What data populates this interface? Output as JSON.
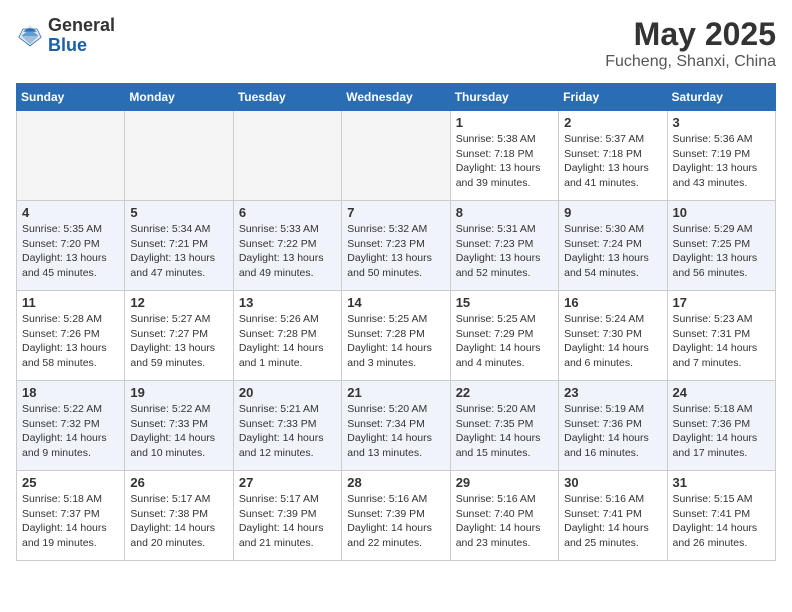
{
  "header": {
    "logo": {
      "general": "General",
      "blue": "Blue"
    },
    "title": "May 2025",
    "location": "Fucheng, Shanxi, China"
  },
  "weekdays": [
    "Sunday",
    "Monday",
    "Tuesday",
    "Wednesday",
    "Thursday",
    "Friday",
    "Saturday"
  ],
  "weeks": [
    [
      {
        "day": "",
        "info": ""
      },
      {
        "day": "",
        "info": ""
      },
      {
        "day": "",
        "info": ""
      },
      {
        "day": "",
        "info": ""
      },
      {
        "day": "1",
        "info": "Sunrise: 5:38 AM\nSunset: 7:18 PM\nDaylight: 13 hours\nand 39 minutes."
      },
      {
        "day": "2",
        "info": "Sunrise: 5:37 AM\nSunset: 7:18 PM\nDaylight: 13 hours\nand 41 minutes."
      },
      {
        "day": "3",
        "info": "Sunrise: 5:36 AM\nSunset: 7:19 PM\nDaylight: 13 hours\nand 43 minutes."
      }
    ],
    [
      {
        "day": "4",
        "info": "Sunrise: 5:35 AM\nSunset: 7:20 PM\nDaylight: 13 hours\nand 45 minutes."
      },
      {
        "day": "5",
        "info": "Sunrise: 5:34 AM\nSunset: 7:21 PM\nDaylight: 13 hours\nand 47 minutes."
      },
      {
        "day": "6",
        "info": "Sunrise: 5:33 AM\nSunset: 7:22 PM\nDaylight: 13 hours\nand 49 minutes."
      },
      {
        "day": "7",
        "info": "Sunrise: 5:32 AM\nSunset: 7:23 PM\nDaylight: 13 hours\nand 50 minutes."
      },
      {
        "day": "8",
        "info": "Sunrise: 5:31 AM\nSunset: 7:23 PM\nDaylight: 13 hours\nand 52 minutes."
      },
      {
        "day": "9",
        "info": "Sunrise: 5:30 AM\nSunset: 7:24 PM\nDaylight: 13 hours\nand 54 minutes."
      },
      {
        "day": "10",
        "info": "Sunrise: 5:29 AM\nSunset: 7:25 PM\nDaylight: 13 hours\nand 56 minutes."
      }
    ],
    [
      {
        "day": "11",
        "info": "Sunrise: 5:28 AM\nSunset: 7:26 PM\nDaylight: 13 hours\nand 58 minutes."
      },
      {
        "day": "12",
        "info": "Sunrise: 5:27 AM\nSunset: 7:27 PM\nDaylight: 13 hours\nand 59 minutes."
      },
      {
        "day": "13",
        "info": "Sunrise: 5:26 AM\nSunset: 7:28 PM\nDaylight: 14 hours\nand 1 minute."
      },
      {
        "day": "14",
        "info": "Sunrise: 5:25 AM\nSunset: 7:28 PM\nDaylight: 14 hours\nand 3 minutes."
      },
      {
        "day": "15",
        "info": "Sunrise: 5:25 AM\nSunset: 7:29 PM\nDaylight: 14 hours\nand 4 minutes."
      },
      {
        "day": "16",
        "info": "Sunrise: 5:24 AM\nSunset: 7:30 PM\nDaylight: 14 hours\nand 6 minutes."
      },
      {
        "day": "17",
        "info": "Sunrise: 5:23 AM\nSunset: 7:31 PM\nDaylight: 14 hours\nand 7 minutes."
      }
    ],
    [
      {
        "day": "18",
        "info": "Sunrise: 5:22 AM\nSunset: 7:32 PM\nDaylight: 14 hours\nand 9 minutes."
      },
      {
        "day": "19",
        "info": "Sunrise: 5:22 AM\nSunset: 7:33 PM\nDaylight: 14 hours\nand 10 minutes."
      },
      {
        "day": "20",
        "info": "Sunrise: 5:21 AM\nSunset: 7:33 PM\nDaylight: 14 hours\nand 12 minutes."
      },
      {
        "day": "21",
        "info": "Sunrise: 5:20 AM\nSunset: 7:34 PM\nDaylight: 14 hours\nand 13 minutes."
      },
      {
        "day": "22",
        "info": "Sunrise: 5:20 AM\nSunset: 7:35 PM\nDaylight: 14 hours\nand 15 minutes."
      },
      {
        "day": "23",
        "info": "Sunrise: 5:19 AM\nSunset: 7:36 PM\nDaylight: 14 hours\nand 16 minutes."
      },
      {
        "day": "24",
        "info": "Sunrise: 5:18 AM\nSunset: 7:36 PM\nDaylight: 14 hours\nand 17 minutes."
      }
    ],
    [
      {
        "day": "25",
        "info": "Sunrise: 5:18 AM\nSunset: 7:37 PM\nDaylight: 14 hours\nand 19 minutes."
      },
      {
        "day": "26",
        "info": "Sunrise: 5:17 AM\nSunset: 7:38 PM\nDaylight: 14 hours\nand 20 minutes."
      },
      {
        "day": "27",
        "info": "Sunrise: 5:17 AM\nSunset: 7:39 PM\nDaylight: 14 hours\nand 21 minutes."
      },
      {
        "day": "28",
        "info": "Sunrise: 5:16 AM\nSunset: 7:39 PM\nDaylight: 14 hours\nand 22 minutes."
      },
      {
        "day": "29",
        "info": "Sunrise: 5:16 AM\nSunset: 7:40 PM\nDaylight: 14 hours\nand 23 minutes."
      },
      {
        "day": "30",
        "info": "Sunrise: 5:16 AM\nSunset: 7:41 PM\nDaylight: 14 hours\nand 25 minutes."
      },
      {
        "day": "31",
        "info": "Sunrise: 5:15 AM\nSunset: 7:41 PM\nDaylight: 14 hours\nand 26 minutes."
      }
    ]
  ]
}
